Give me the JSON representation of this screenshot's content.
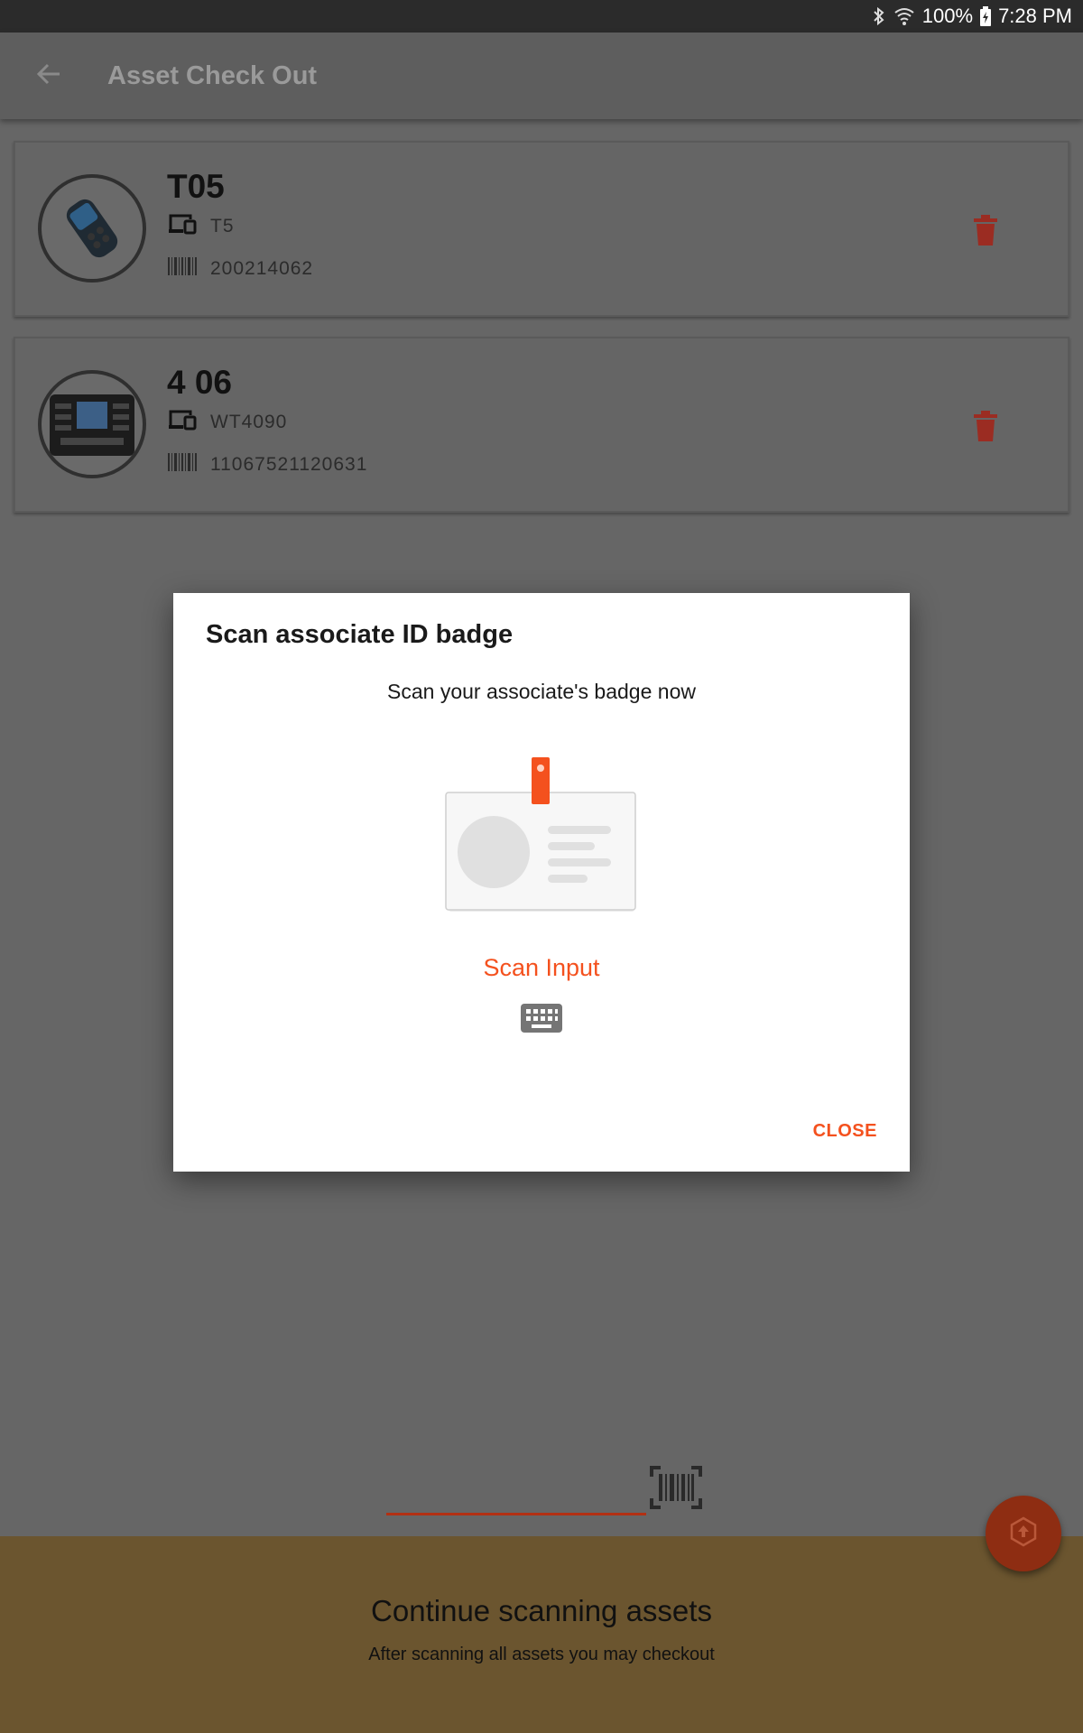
{
  "status_bar": {
    "battery": "100%",
    "time": "7:28 PM"
  },
  "app_bar": {
    "title": "Asset Check Out"
  },
  "assets": [
    {
      "name": "T05",
      "model": "T5",
      "barcode": "200214062"
    },
    {
      "name": "4 06",
      "model": "WT4090",
      "barcode": "11067521120631"
    }
  ],
  "dialog": {
    "title": "Scan associate ID badge",
    "message": "Scan your associate's badge now",
    "scan_input_label": "Scan Input",
    "close_label": "CLOSE"
  },
  "bottom_panel": {
    "heading": "Continue scanning assets",
    "subtext": "After scanning all assets you may checkout"
  },
  "colors": {
    "accent": "#f4511e",
    "delete": "#c0392b",
    "bottom_panel": "#6b552f"
  }
}
